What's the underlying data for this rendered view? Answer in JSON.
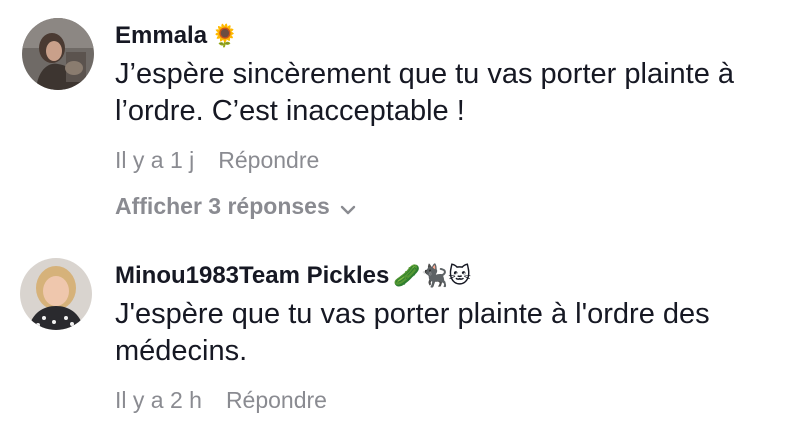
{
  "comments": [
    {
      "author": "Emmala",
      "author_emoji": "🌻",
      "text_lines": [
        "J’espère sincèrement que tu vas porter plainte à",
        "l’ordre. C’est inacceptable !"
      ],
      "time": "Il y a 1 j",
      "reply_label": "Répondre",
      "view_replies_label": "Afficher 3 réponses",
      "avatar_icon": "user-avatar-photo"
    },
    {
      "author": "Minou1983Team Pickles",
      "author_emoji": "🥒🐈‍⬛🐱",
      "text_lines": [
        "J'espère que tu vas porter plainte à l'ordre des",
        "médecins."
      ],
      "time": "Il y a 2 h",
      "reply_label": "Répondre",
      "avatar_icon": "user-avatar-photo"
    }
  ],
  "icons": {
    "expand": "chevron-down-icon"
  },
  "colors": {
    "primary_text": "#161823",
    "secondary_text": "#8a8b91",
    "background": "#ffffff"
  }
}
